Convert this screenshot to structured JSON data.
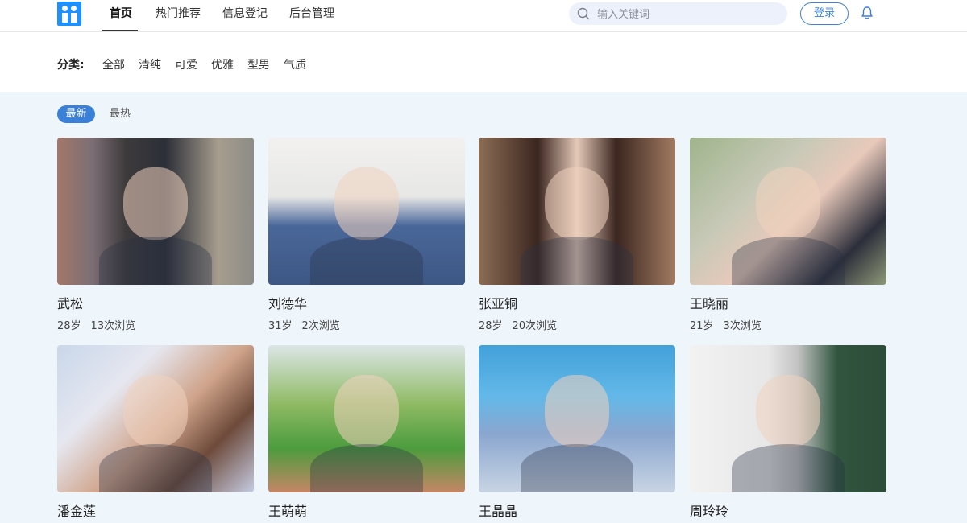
{
  "nav": {
    "items": [
      "首页",
      "热门推荐",
      "信息登记",
      "后台管理"
    ],
    "active": "首页"
  },
  "search": {
    "placeholder": "输入关键词",
    "value": ""
  },
  "login_label": "登录",
  "categories": {
    "label": "分类:",
    "items": [
      "全部",
      "清纯",
      "可爱",
      "优雅",
      "型男",
      "气质"
    ]
  },
  "sort_tabs": [
    "最新",
    "最热"
  ],
  "people": [
    {
      "name": "武松",
      "age": "28岁",
      "views": "13次浏览"
    },
    {
      "name": "刘德华",
      "age": "31岁",
      "views": "2次浏览"
    },
    {
      "name": "张亚铜",
      "age": "28岁",
      "views": "20次浏览"
    },
    {
      "name": "王晓丽",
      "age": "21岁",
      "views": "3次浏览"
    },
    {
      "name": "潘金莲"
    },
    {
      "name": "王萌萌"
    },
    {
      "name": "王晶晶"
    },
    {
      "name": "周玲玲"
    }
  ],
  "colors": {
    "accent": "#3a7fd8",
    "logo": "#1e90ff",
    "page_bg": "#eef6fb"
  },
  "icons": [
    "logo-icon",
    "search-icon",
    "bell-icon"
  ]
}
